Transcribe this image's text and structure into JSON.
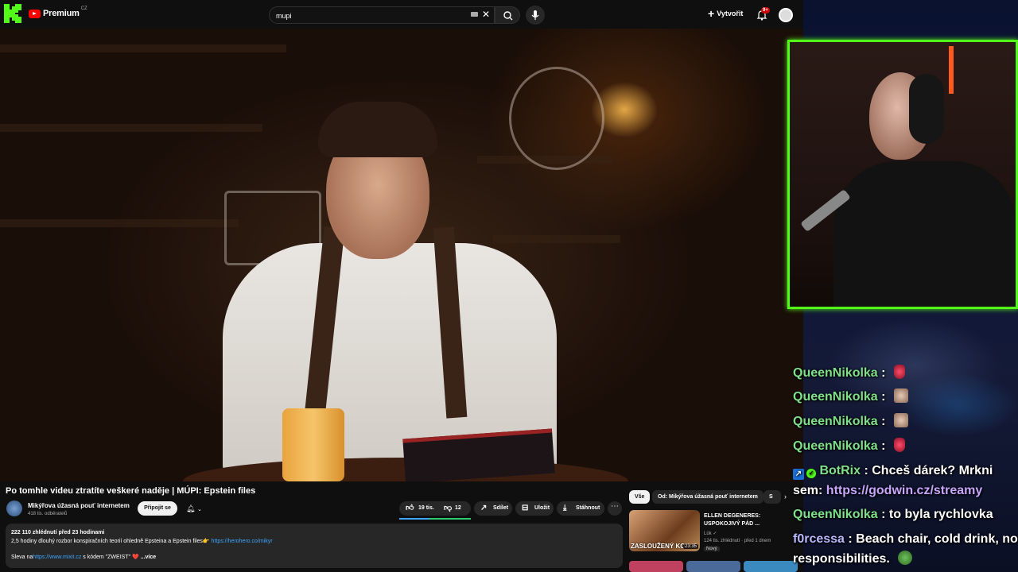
{
  "youtube": {
    "brand": "Premium",
    "region": "CZ",
    "search_value": "mupi",
    "create_label": "Vytvořit",
    "notif_badge": "9+",
    "video_title": "Po tomhle videu ztratíte veškeré naděje | MÚPI: Epstein files",
    "channel_name": "Mikýřova úžasná pouť internetem",
    "channel_subs": "418 tis. odběratelů",
    "join_label": "Připojit se",
    "likes": "19 tis.",
    "dislikes": "12",
    "share_label": "Sdílet",
    "save_label": "Uložit",
    "download_label": "Stáhnout",
    "description": {
      "meta": "222 110 zhlédnutí  před 23 hodinami",
      "line1": "2,5 hodiny dlouhý rozbor konspiračních teorií ohledně Epsteina a Epstein files👉",
      "link1": "https://herohero.co/mikyr",
      "line2_prefix": "Sleva na",
      "link2": "https://www.mixit.cz",
      "line2_suffix": " s kódem \"ZWEIST\" ❤️",
      "more": "...více"
    },
    "chips": [
      "Vše",
      "Od: Mikýřova úžasná pouť internetem",
      "S"
    ],
    "recommended": {
      "title": "ELLEN DEGENERES: USPOKOJIVÝ PÁD ...",
      "channel": "Lük ✓",
      "meta": "124 tis. zhlédnutí · před 1 dnem",
      "badge": "Nový",
      "thumb_text": "ZASLOUŽENÝ KO",
      "duration": "23:35"
    }
  },
  "chat": [
    {
      "user": "QueenNikolka",
      "sep": " :",
      "msg": "",
      "emote": "red"
    },
    {
      "user": "QueenNikolka",
      "sep": " :",
      "msg": "",
      "emote": "face"
    },
    {
      "user": "QueenNikolka",
      "sep": " :",
      "msg": "",
      "emote": "face"
    },
    {
      "user": "QueenNikolka",
      "sep": " :",
      "msg": "",
      "emote": "red"
    },
    {
      "user": "BotRix",
      "sep": " :",
      "msg": " Chceš dárek? Mrkni",
      "cont_prefix": "sem: ",
      "cont_link": "https://godwin.cz/streamy"
    },
    {
      "user": "QueenNikolka",
      "sep": " :",
      "msg": " to byla rychlovka"
    },
    {
      "user": "f0rcessa",
      "sep": " :",
      "msg": " Beach chair, cold drink, no",
      "cont_prefix": "responsibilities.",
      "emote": "pepe"
    }
  ],
  "colors": {
    "kick_green": "#53fc18",
    "yt_red": "#ff0000",
    "link_blue": "#3ea6ff",
    "chat_user_green": "#7fe08a",
    "chat_link_purple": "#c8a6ff"
  },
  "icons": [
    "kick-logo-icon",
    "youtube-logo-icon",
    "keyboard-icon",
    "clear-icon",
    "search-icon",
    "mic-icon",
    "plus-icon",
    "bell-icon",
    "avatar-icon",
    "like-icon",
    "dislike-icon",
    "share-icon",
    "save-icon",
    "download-icon",
    "more-icon",
    "chevron-right-icon"
  ]
}
